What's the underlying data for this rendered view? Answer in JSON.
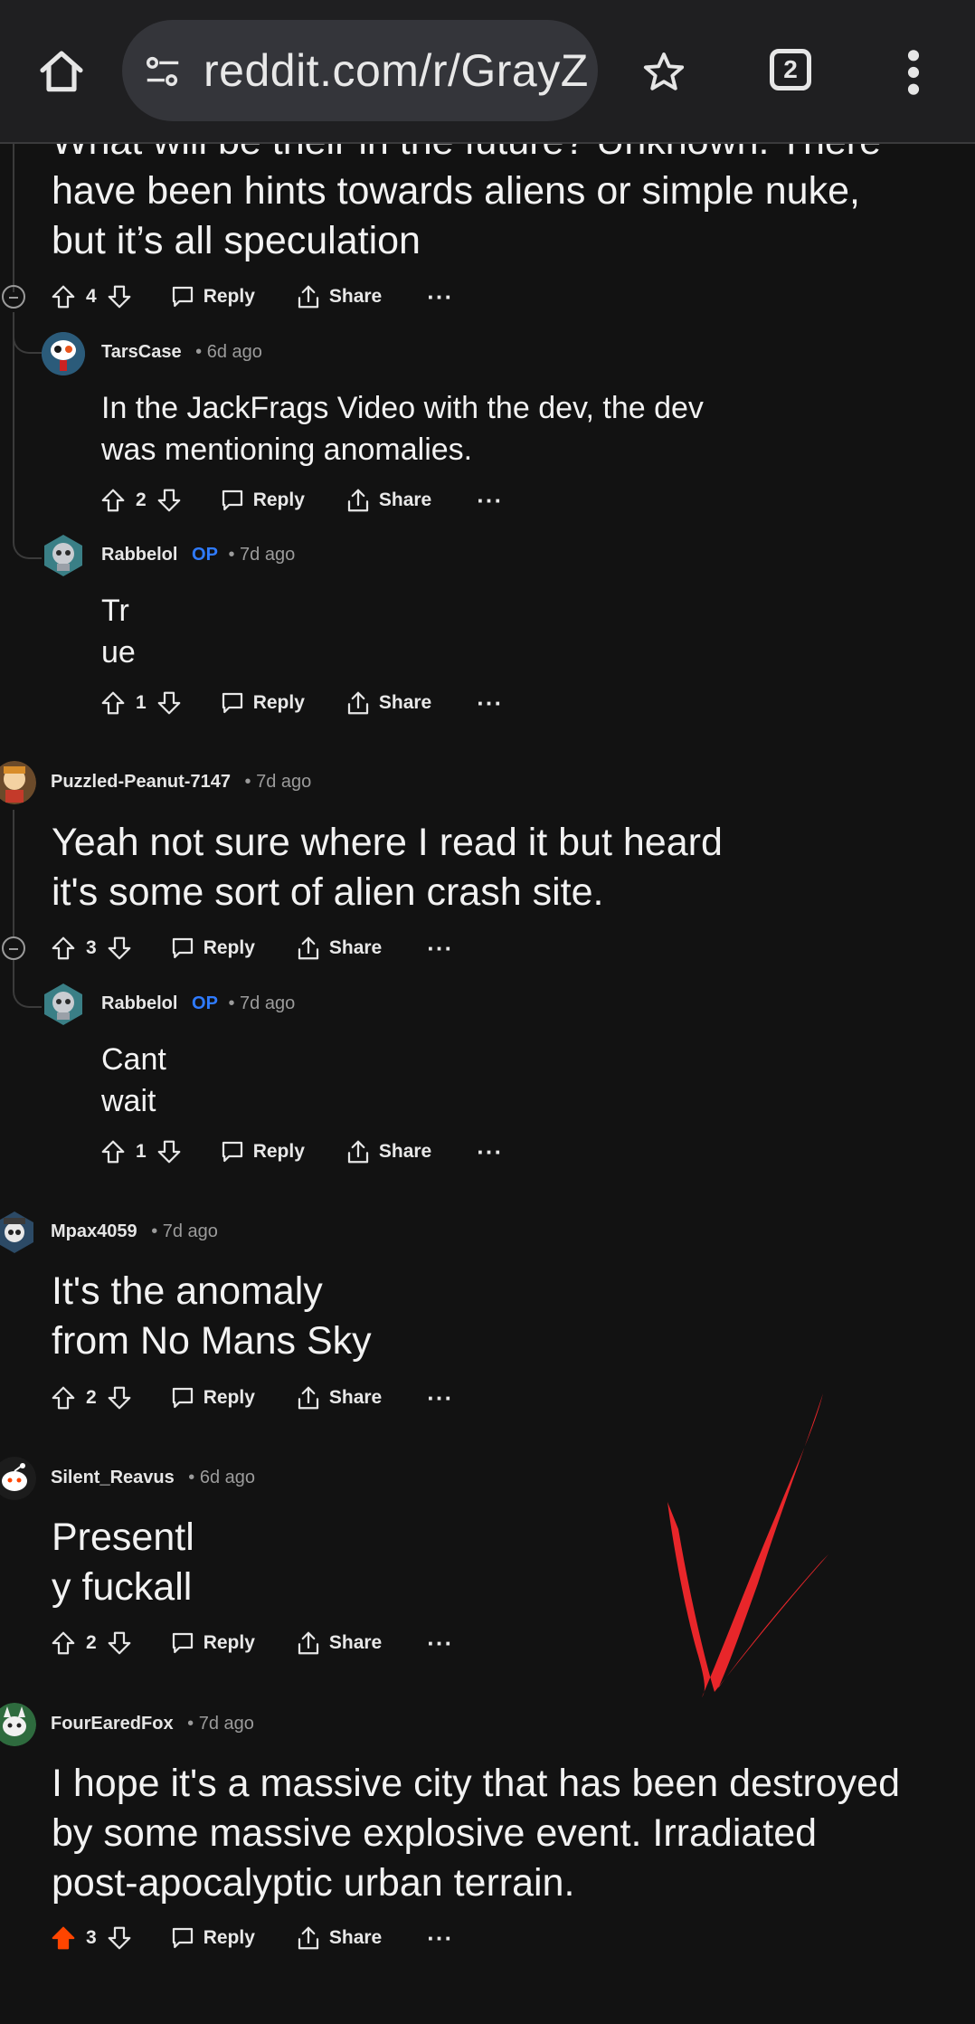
{
  "browser": {
    "url": "reddit.com/r/GrayZ",
    "tab_count": "2"
  },
  "comments": [
    {
      "text": "What will be their in the future? Unknown. There\nhave been hints towards aliens or simple nuke,\nbut it’s all speculation",
      "votes": "4",
      "reply": "Reply",
      "share": "Share"
    },
    {
      "user": "TarsCase",
      "time": "• 6d ago",
      "text": "In the JackFrags Video with the dev, the dev\nwas mentioning anomalies.",
      "votes": "2",
      "reply": "Reply",
      "share": "Share"
    },
    {
      "user": "Rabbelol",
      "op": "OP",
      "time": "• 7d ago",
      "text": "Tr\nue",
      "votes": "1",
      "reply": "Reply",
      "share": "Share"
    },
    {
      "user": "Puzzled-Peanut-7147",
      "time": "• 7d ago",
      "text": "Yeah not sure where I read it but heard\nit's some sort of alien crash site.",
      "votes": "3",
      "reply": "Reply",
      "share": "Share"
    },
    {
      "user": "Rabbelol",
      "op": "OP",
      "time": "• 7d ago",
      "text": "Cant\nwait",
      "votes": "1",
      "reply": "Reply",
      "share": "Share"
    },
    {
      "user": "Mpax4059",
      "time": "• 7d ago",
      "text": "It's the anomaly\nfrom No Mans Sky",
      "votes": "2",
      "reply": "Reply",
      "share": "Share"
    },
    {
      "user": "Silent_Reavus",
      "time": "• 6d ago",
      "text": "Presentl\ny fuckall",
      "votes": "2",
      "reply": "Reply",
      "share": "Share"
    },
    {
      "user": "FourEaredFox",
      "time": "• 7d ago",
      "text": "I hope it's a massive city that has been destroyed\nby some massive explosive event. Irradiated\npost-apocalyptic urban terrain.",
      "votes": "3",
      "reply": "Reply",
      "share": "Share"
    }
  ],
  "colors": {
    "background": "#121212",
    "upvoted": "#ff4500",
    "op_badge": "#2f7bff",
    "annotation": "#e8262a"
  },
  "annotation_icon": "red-checkmark-annotation"
}
